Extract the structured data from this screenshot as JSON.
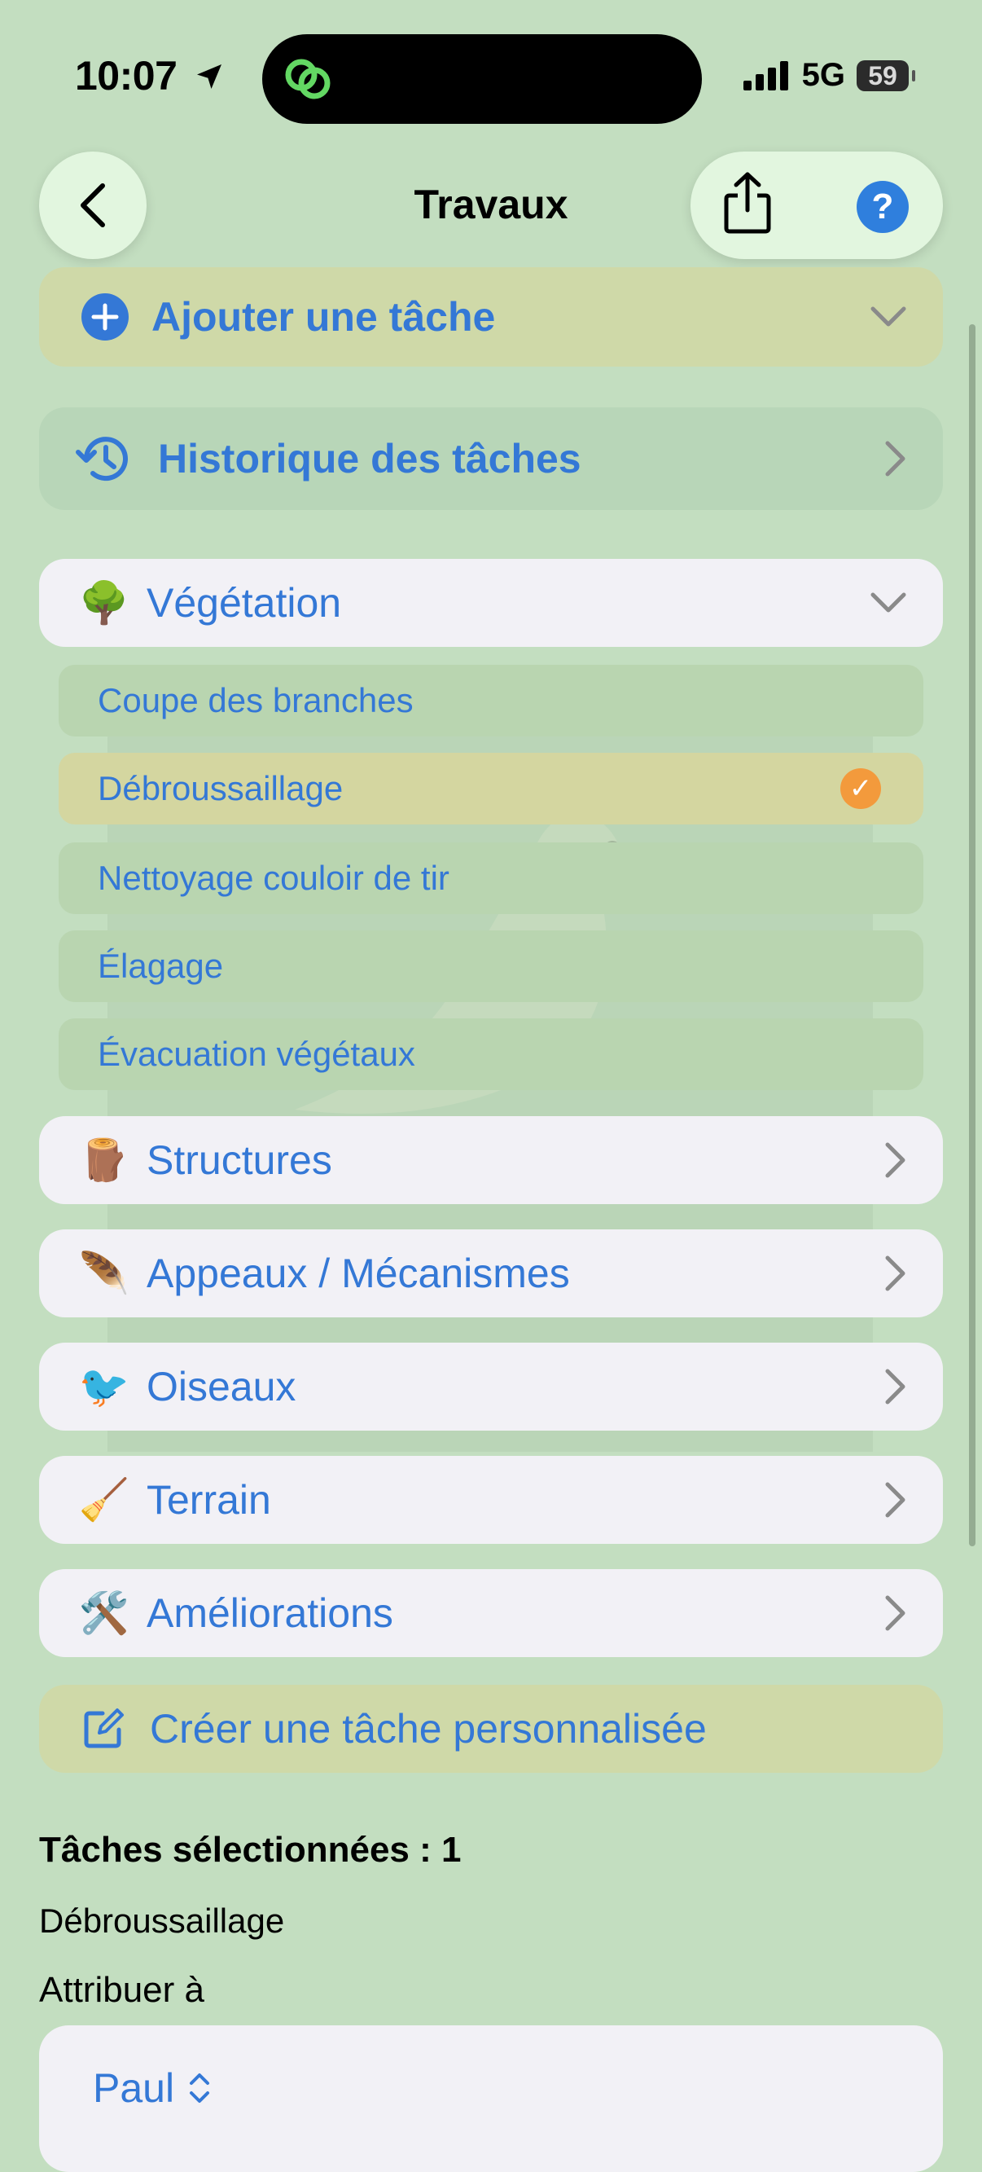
{
  "status_bar": {
    "time": "10:07",
    "network": "5G",
    "battery": "59"
  },
  "nav": {
    "title": "Travaux"
  },
  "add_task": {
    "label": "Ajouter une tâche"
  },
  "history": {
    "label": "Historique des tâches"
  },
  "categories": [
    {
      "emoji": "🌳",
      "label": "Végétation",
      "expanded": true
    },
    {
      "emoji": "🪵",
      "label": "Structures",
      "expanded": false
    },
    {
      "emoji": "🪶",
      "label": "Appeaux / Mécanismes",
      "expanded": false
    },
    {
      "emoji": "🐦",
      "label": "Oiseaux",
      "expanded": false
    },
    {
      "emoji": "🧹",
      "label": "Terrain",
      "expanded": false
    },
    {
      "emoji": "🛠️",
      "label": "Améliorations",
      "expanded": false
    }
  ],
  "vegetation_tasks": [
    {
      "label": "Coupe des branches",
      "selected": false
    },
    {
      "label": "Débroussaillage",
      "selected": true
    },
    {
      "label": "Nettoyage couloir de tir",
      "selected": false
    },
    {
      "label": "Élagage",
      "selected": false
    },
    {
      "label": "Évacuation végétaux",
      "selected": false
    }
  ],
  "custom_task": {
    "label": "Créer une tâche personnalisée"
  },
  "selection": {
    "title": "Tâches sélectionnées : 1",
    "items": [
      "Débroussaillage"
    ],
    "assign_label": "Attribuer à",
    "assignee": "Paul"
  },
  "colors": {
    "accent": "#3478d6",
    "background": "#c3dec0",
    "check": "#f39a3c",
    "help": "#2f7fdd"
  },
  "icons": [
    "location-arrow-icon",
    "link-icon",
    "cellular-signal-icon",
    "battery-icon",
    "back-chevron-icon",
    "share-icon",
    "help-icon",
    "plus-circle-icon",
    "history-icon",
    "chevron-down-icon",
    "chevron-right-icon",
    "checkmark-icon",
    "edit-icon",
    "updown-chevron-icon"
  ]
}
